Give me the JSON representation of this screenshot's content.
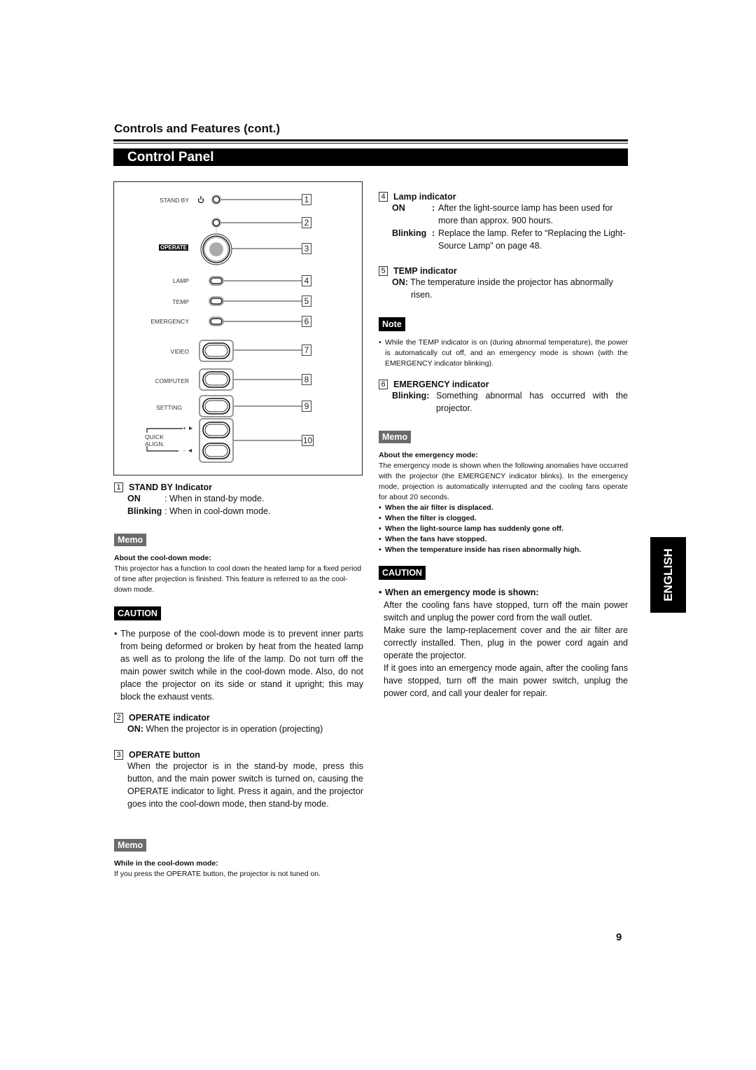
{
  "header": {
    "section_title": "Controls and Features (cont.)",
    "banner_title": "Control Panel"
  },
  "panel": {
    "labels": {
      "standby": "STAND BY",
      "operate": "OPERATE",
      "lamp": "LAMP",
      "temp": "TEMP",
      "emergency": "EMERGENCY",
      "video": "VIDEO",
      "computer": "COMPUTER",
      "setting": "SETTING",
      "quick": "QUICK",
      "align": "ALIGN.",
      "plus": "+ ►",
      "minus": "- ◄"
    },
    "callouts": [
      "1",
      "2",
      "3",
      "4",
      "5",
      "6",
      "7",
      "8",
      "9",
      "10"
    ]
  },
  "left": {
    "standby": {
      "num": "1",
      "title": "STAND BY Indicator",
      "on_label": "ON",
      "on_text": ": When in stand-by mode.",
      "blink_label": "Blinking",
      "blink_text": ": When in cool-down mode."
    },
    "memo1": {
      "tag": "Memo",
      "heading": "About the cool-down mode:",
      "body": "This projector has a function to cool down the heated lamp for a fixed period  of time after projection is finished. This feature is referred to as the cool-down mode."
    },
    "caution1": {
      "tag": "CAUTION",
      "body": "The purpose of the cool-down mode is to prevent inner parts from being deformed or broken by heat from the heated lamp as well as to prolong the life of the lamp. Do not turn off the main power switch while in the cool-down mode. Also, do not place the projector on its side or stand it upright; this may block the exhaust vents."
    },
    "operate_indicator": {
      "num": "2",
      "title": "OPERATE indicator",
      "on_label": "ON:",
      "on_text": " When the projector is in operation (projecting)"
    },
    "operate_button": {
      "num": "3",
      "title": "OPERATE button",
      "body": "When the projector is in the stand-by mode, press this button, and the main power switch is turned on, causing the OPERATE indicator to light. Press it again, and the projector goes into the cool-down mode, then stand-by mode."
    },
    "memo2": {
      "tag": "Memo",
      "heading": "While in the cool-down mode:",
      "body": "If you press the OPERATE button, the projector is not tuned on."
    }
  },
  "right": {
    "lamp": {
      "num": "4",
      "title": "Lamp indicator",
      "on_label": "ON",
      "on_text": "After the light-source lamp has been used for more than approx. 900 hours.",
      "blink_label": "Blinking",
      "blink_text": "Replace the lamp. Refer to “Replacing the Light-Source Lamp” on page 48."
    },
    "temp": {
      "num": "5",
      "title": "TEMP indicator",
      "on_label": "ON:",
      "on_text": " The temperature inside the projector has abnormally risen."
    },
    "note": {
      "tag": "Note",
      "body": "While the TEMP indicator is on (during abnormal temperature), the power is automatically cut off, and an emergency mode is shown (with the EMERGENCY indicator blinking)."
    },
    "emergency": {
      "num": "6",
      "title": "EMERGENCY indicator",
      "blink_label": "Blinking:",
      "blink_text": "Something abnormal has occurred with the projector."
    },
    "memo": {
      "tag": "Memo",
      "heading": "About the emergency mode:",
      "body": "The emergency mode is shown when the following anomalies have occurred with the projector (the EMERGENCY indicator blinks). In the emergency mode, projection is automatically interrupted and the cooling fans operate for about 20 seconds.",
      "items": [
        "When the air filter is displaced.",
        "When the filter is clogged.",
        "When the light-source lamp has suddenly gone off.",
        "When the fans have stopped.",
        "When the temperature inside has risen abnormally high."
      ]
    },
    "caution": {
      "tag": "CAUTION",
      "heading": "When an emergency mode is shown:",
      "paragraphs": [
        "After the cooling fans have stopped, turn off the main power switch and unplug the power cord from the wall outlet.",
        "Make sure the lamp-replacement cover and the air filter are correctly installed. Then, plug in the power cord again and operate the projector.",
        "If it goes into an emergency mode again, after the cooling fans have stopped, turn off the main power switch, unplug the power cord, and call your dealer for repair."
      ]
    }
  },
  "side_tab": "ENGLISH",
  "page_number": "9"
}
